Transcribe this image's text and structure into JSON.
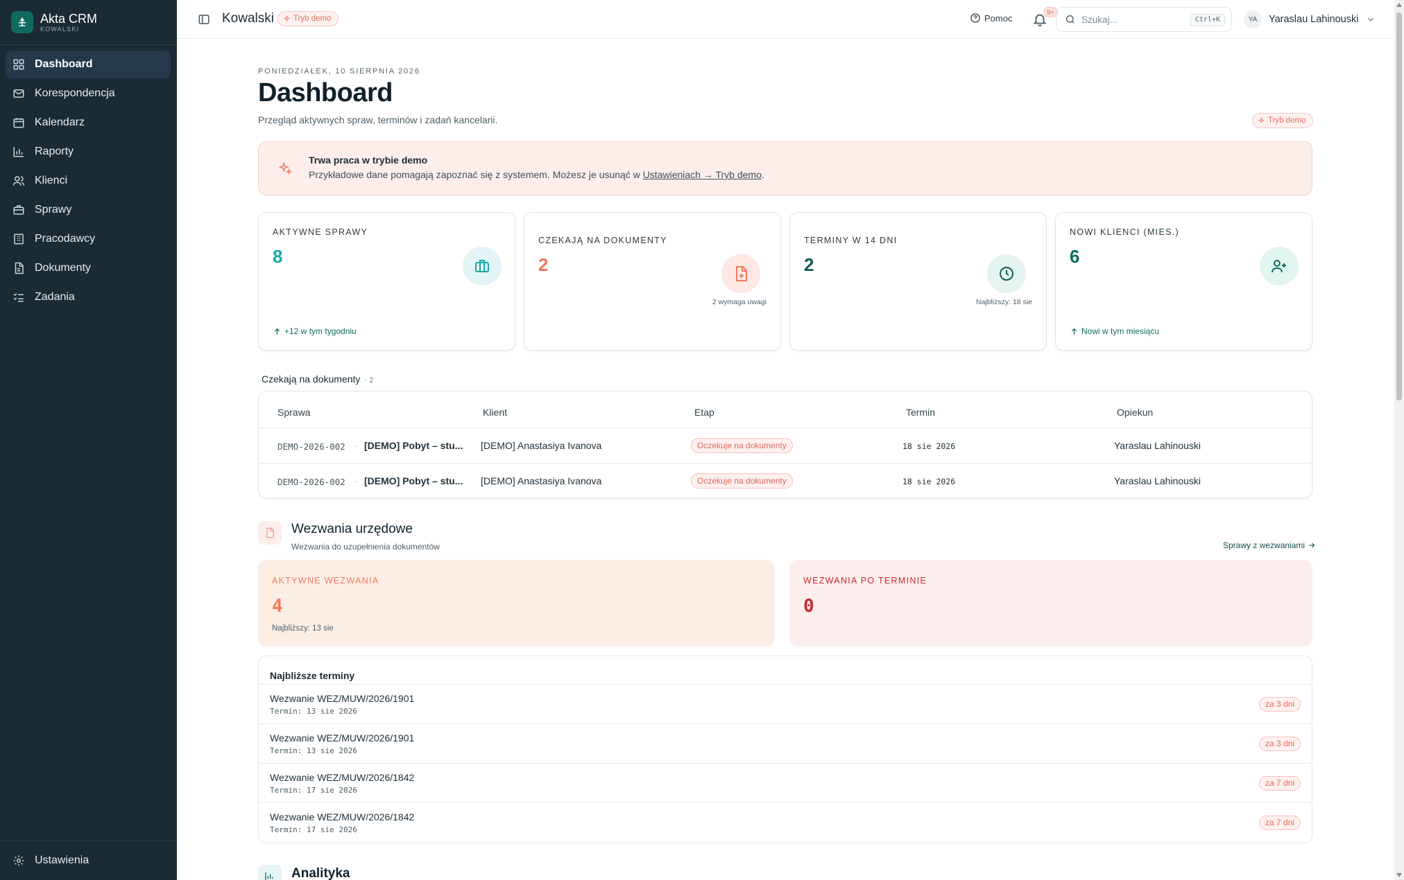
{
  "brand": {
    "name": "Akta CRM",
    "sub": "KOWALSKI"
  },
  "sidebar": {
    "items": [
      {
        "label": "Dashboard",
        "icon": "grid-icon",
        "active": true
      },
      {
        "label": "Korespondencja",
        "icon": "mail-icon"
      },
      {
        "label": "Kalendarz",
        "icon": "calendar-icon"
      },
      {
        "label": "Raporty",
        "icon": "bar-chart-icon"
      },
      {
        "label": "Klienci",
        "icon": "users-icon"
      },
      {
        "label": "Sprawy",
        "icon": "briefcase-icon"
      },
      {
        "label": "Pracodawcy",
        "icon": "building-icon"
      },
      {
        "label": "Dokumenty",
        "icon": "document-icon"
      },
      {
        "label": "Zadania",
        "icon": "checklist-icon"
      }
    ],
    "settings_label": "Ustawienia"
  },
  "topbar": {
    "title": "Kowalski",
    "demo_badge": "Tryb demo",
    "help_label": "Pomoc",
    "notif_badge": "9+",
    "search_placeholder": "Szukaj...",
    "search_shortcut": "Ctrl+K",
    "user_initials": "YA",
    "user_name": "Yaraslau Lahinouski"
  },
  "page": {
    "date": "PONIEDZIAŁEK, 10 SIERPNIA 2026",
    "title": "Dashboard",
    "subtitle": "Przegląd aktywnych spraw, terminów i zadań kancelarii.",
    "demo_badge": "Tryb demo"
  },
  "banner": {
    "title": "Trwa praca w trybie demo",
    "text": "Przykładowe dane pomagają zapoznać się z systemem. Możesz je usunąć w ",
    "link": "Ustawieniach → Tryb demo",
    "text_end": "."
  },
  "stats": [
    {
      "label": "AKTYWNE SPRAWY",
      "value": "8",
      "foot": "+12 w tym tygodniu",
      "icon": "briefcase-icon",
      "color": "#1aa7a7"
    },
    {
      "label": "CZEKAJĄ NA DOKUMENTY",
      "value": "2",
      "note": "2 wymaga uwagi",
      "icon": "file-plus-icon",
      "color": "#ef7a5e"
    },
    {
      "label": "TERMINY W 14 DNI",
      "value": "2",
      "note": "Najbliższy: 18 sie",
      "icon": "clock-icon",
      "color": "#0f5b52"
    },
    {
      "label": "NOWI KLIENCI (MIES.)",
      "value": "6",
      "foot": "Nowi w tym miesiącu",
      "icon": "user-plus-icon",
      "color": "#0f6b5e"
    }
  ],
  "waiting": {
    "title": "Czekają na dokumenty",
    "count": "2",
    "columns": [
      "Sprawa",
      "Klient",
      "Etap",
      "Termin",
      "Opiekun"
    ],
    "rows": [
      {
        "id": "DEMO-2026-002",
        "case": "[DEMO] Pobyt – stu...",
        "client": "[DEMO] Anastasiya Ivanova",
        "stage": "Oczekuje na dokumenty",
        "deadline": "18 sie 2026",
        "owner": "Yaraslau Lahinouski"
      },
      {
        "id": "DEMO-2026-002",
        "case": "[DEMO] Pobyt – stu...",
        "client": "[DEMO] Anastasiya Ivanova",
        "stage": "Oczekuje na dokumenty",
        "deadline": "18 sie 2026",
        "owner": "Yaraslau Lahinouski"
      }
    ]
  },
  "summons": {
    "title": "Wezwania urzędowe",
    "subtitle": "Wezwania do uzupełnienia dokumentów",
    "link": "Sprawy z wezwaniami",
    "active": {
      "label": "AKTYWNE WEZWANIA",
      "value": "4",
      "note": "Najbliższy: 13 sie"
    },
    "overdue": {
      "label": "WEZWANIA PO TERMINIE",
      "value": "0"
    },
    "list_title": "Najbliższe terminy",
    "items": [
      {
        "title": "Wezwanie WEZ/MUW/2026/1901",
        "date": "Termin: 13 sie 2026",
        "badge": "za 3 dni"
      },
      {
        "title": "Wezwanie WEZ/MUW/2026/1901",
        "date": "Termin: 13 sie 2026",
        "badge": "za 3 dni"
      },
      {
        "title": "Wezwanie WEZ/MUW/2026/1842",
        "date": "Termin: 17 sie 2026",
        "badge": "za 7 dni"
      },
      {
        "title": "Wezwanie WEZ/MUW/2026/1842",
        "date": "Termin: 17 sie 2026",
        "badge": "za 7 dni"
      }
    ]
  },
  "analytics": {
    "title": "Analityka"
  }
}
